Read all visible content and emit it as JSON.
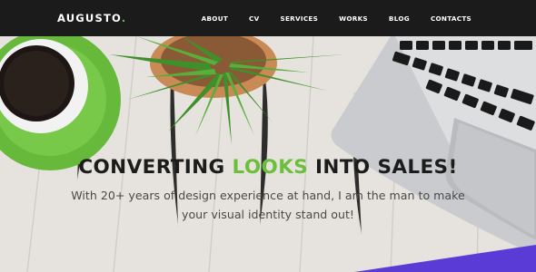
{
  "brand": {
    "name": "AUGUSTO",
    "dot": ".",
    "accent_color": "#6bbf3b"
  },
  "nav": {
    "items": [
      {
        "label": "ABOUT"
      },
      {
        "label": "CV"
      },
      {
        "label": "SERVICES"
      },
      {
        "label": "WORKS"
      },
      {
        "label": "BLOG"
      },
      {
        "label": "CONTACTS"
      }
    ]
  },
  "hero": {
    "title_part1": "CONVERTING ",
    "title_accent": "LOOKS",
    "title_part2": " INTO SALES!",
    "subtitle": "With 20+ years of design experience at hand, I am the man to make your visual identity stand out!"
  },
  "colors": {
    "navbar": "#1b1b1b",
    "accent": "#6bbf3b",
    "decor_purple": "#5b3bd6"
  }
}
